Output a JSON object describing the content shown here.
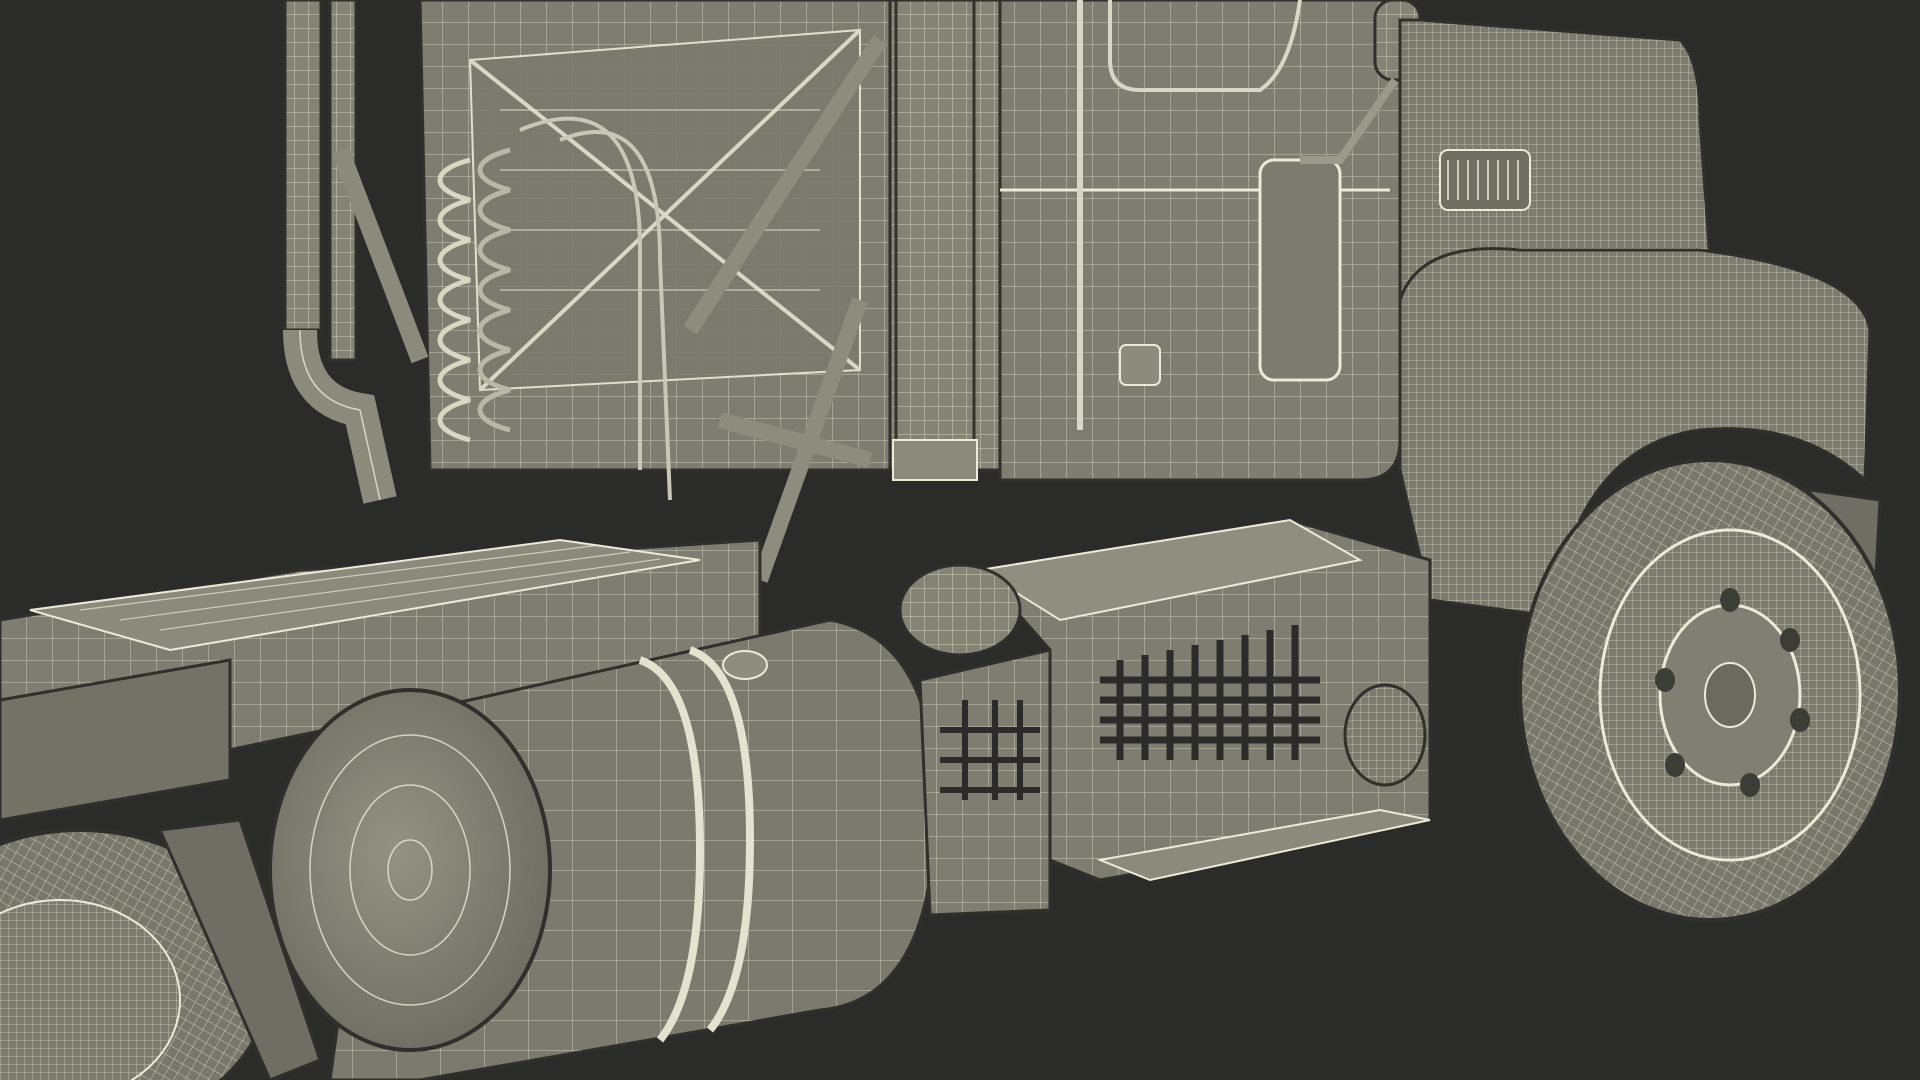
{
  "scene": {
    "subject": "truck-wireframe-render",
    "colors": {
      "background": "#2b2b2a",
      "surface": "#7f7f73",
      "surface_light": "#9a9a8c",
      "surface_dark": "#5e5e55",
      "wire": "#e9e8d6",
      "edge": "#2f2f2b"
    }
  }
}
